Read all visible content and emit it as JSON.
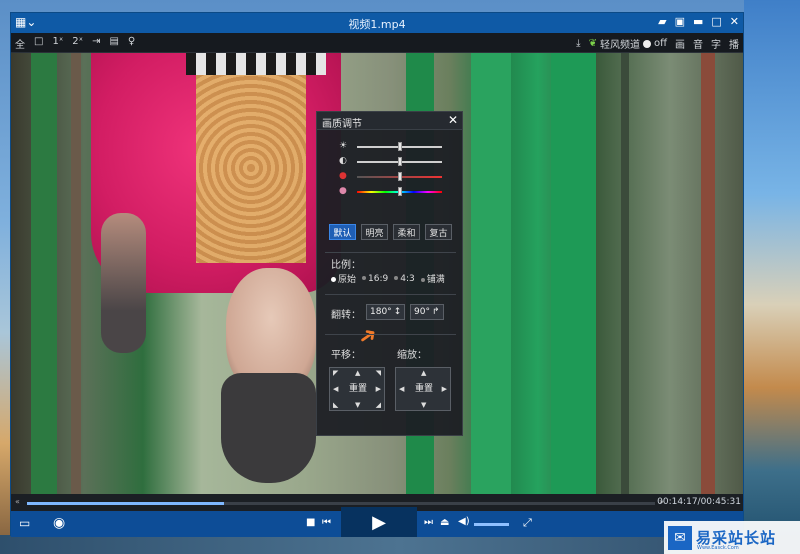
{
  "window": {
    "title": "视频1.mp4",
    "menu_icon": "grid-menu-icon",
    "buttons": [
      "message-icon",
      "skin-icon",
      "minimize-icon",
      "maximize-icon",
      "close-icon"
    ]
  },
  "toolbar": {
    "fullscreen": "全",
    "mini": "□",
    "speed_1x": "1ˣ",
    "speed_2x": "2ˣ",
    "pin": "⇥",
    "list": "▤",
    "light": "♀",
    "download": "⤓",
    "channel_label": "轻风频道",
    "channel_state": "off",
    "right_items": [
      "画",
      "音",
      "字",
      "播"
    ]
  },
  "dialog": {
    "title": "画质调节",
    "close": "✕",
    "sliders": [
      {
        "name": "brightness",
        "icon": "☀",
        "level": 0.5
      },
      {
        "name": "contrast",
        "icon": "◐",
        "level": 0.5
      },
      {
        "name": "saturation",
        "icon": "●",
        "level": 0.5
      },
      {
        "name": "hue",
        "icon": "●",
        "level": 0.5
      }
    ],
    "presets": [
      "默认",
      "明亮",
      "柔和",
      "复古"
    ],
    "active_preset": "默认",
    "ratio_label": "比例：",
    "ratios": [
      "原始",
      "16:9",
      "4:3",
      "铺满"
    ],
    "selected_ratio": "原始",
    "flip_label": "翻转：",
    "flip_180": "180°",
    "flip_90": "90°",
    "pan_label": "平移：",
    "zoom_label": "缩放：",
    "reset_label": "重置"
  },
  "progress": {
    "time": "00:14:17/00:45:31",
    "played_fraction": 0.314
  },
  "controls": {
    "left_icons": [
      "playlist-icon",
      "eye-icon"
    ],
    "stop": "■",
    "prev": "⏮",
    "play": "▶",
    "next": "⏭",
    "eject": "⏏",
    "volume_icon": "🔊",
    "fullscreen_icon": "⛶",
    "volume_fraction": 1.0
  },
  "watermark": {
    "text": "易采站长站",
    "sub": "Www.Easck.Com"
  }
}
